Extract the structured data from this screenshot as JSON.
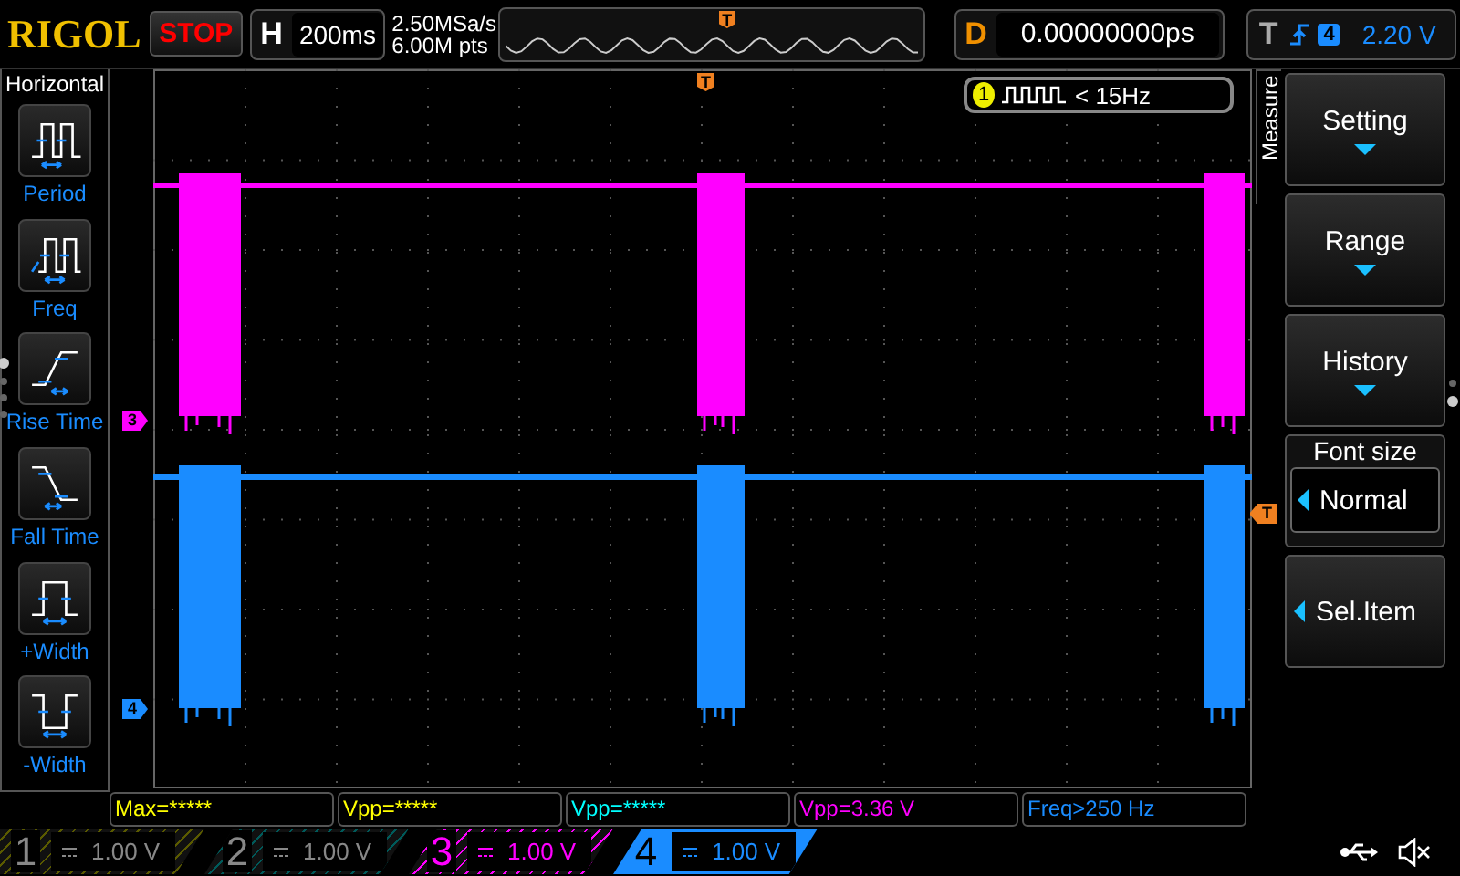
{
  "logo": "RIGOL",
  "run_button": {
    "label": "STOP"
  },
  "timebase": {
    "prefix": "H",
    "value": "200ms"
  },
  "sample_rate": "2.50MSa/s",
  "memory_depth": "6.00M pts",
  "overview": {
    "trigger_mark": "T"
  },
  "delay": {
    "prefix": "D",
    "value": "0.00000000ps"
  },
  "trigger": {
    "prefix": "T",
    "source": "4",
    "level": "2.20 V"
  },
  "left_menu": {
    "title": "Horizontal",
    "items": [
      {
        "kind": "period",
        "label": "Period"
      },
      {
        "kind": "freq",
        "label": "Freq"
      },
      {
        "kind": "rise",
        "label": "Rise Time"
      },
      {
        "kind": "fall",
        "label": "Fall Time"
      },
      {
        "kind": "pwidth",
        "label": "+Width"
      },
      {
        "kind": "nwidth",
        "label": "-Width"
      }
    ],
    "page_dots": [
      {
        "selected": true
      },
      {
        "selected": false
      },
      {
        "selected": false
      },
      {
        "selected": false
      }
    ]
  },
  "screen": {
    "trigger_position_mark": "T",
    "trigger_level_mark": "T",
    "channel_markers": [
      {
        "label": "3",
        "color": "#ff00ff"
      },
      {
        "label": "4",
        "color": "#1a8cff"
      }
    ],
    "counter": {
      "channel": "1",
      "reading": "< 15Hz"
    }
  },
  "right_menu": {
    "title": "Measure",
    "items": [
      {
        "kind": "dropdown",
        "label": "Setting"
      },
      {
        "kind": "dropdown",
        "label": "Range"
      },
      {
        "kind": "dropdown",
        "label": "History"
      },
      {
        "kind": "option",
        "title": "Font size",
        "value": "Normal"
      },
      {
        "kind": "select",
        "label": "Sel.Item"
      }
    ],
    "page_dots": [
      {
        "selected": false
      },
      {
        "selected": true
      }
    ]
  },
  "measurements": [
    {
      "text": "Max=*****",
      "color": "#ffff00"
    },
    {
      "text": "Vpp=*****",
      "color": "#ffff00"
    },
    {
      "text": "Vpp=*****",
      "color": "#00ffff"
    },
    {
      "text": "Vpp=3.36 V",
      "color": "#ff00ff"
    },
    {
      "text": "Freq>250 Hz",
      "color": "#1a8cff"
    }
  ],
  "channels": [
    {
      "number": "1",
      "scale": "1.00 V",
      "color": "#5a5a00",
      "on": false,
      "selected": false
    },
    {
      "number": "2",
      "scale": "1.00 V",
      "color": "#005a5a",
      "on": false,
      "selected": false
    },
    {
      "number": "3",
      "scale": "1.00 V",
      "color": "#ff00ff",
      "on": true,
      "selected": false
    },
    {
      "number": "4",
      "scale": "1.00 V",
      "color": "#1a8cff",
      "on": true,
      "selected": true
    }
  ]
}
